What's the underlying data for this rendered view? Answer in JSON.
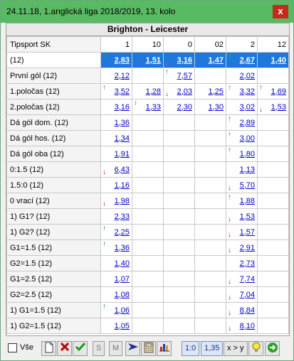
{
  "window": {
    "title": "24.11.18, 1.anglická liga 2018/2019, 13. kolo",
    "close_glyph": "x"
  },
  "match": "Brighton - Leicester",
  "header": [
    "Tipsport SK",
    "1",
    "10",
    "0",
    "02",
    "2",
    "12"
  ],
  "rows": [
    {
      "label": "(12)",
      "selected": true,
      "cells": [
        {
          "v": "2,83",
          "a": "up"
        },
        {
          "v": "1,51"
        },
        {
          "v": "3,16",
          "a": "down"
        },
        {
          "v": "1,47"
        },
        {
          "v": "2,67",
          "a": "up"
        },
        {
          "v": "1,40"
        }
      ]
    },
    {
      "label": "První gól  (12)",
      "cells": [
        {
          "v": "2,12"
        },
        {
          "v": ""
        },
        {
          "v": "7,57",
          "a": "up"
        },
        {
          "v": ""
        },
        {
          "v": "2,02"
        },
        {
          "v": ""
        }
      ]
    },
    {
      "label": "1.poločas  (12)",
      "cells": [
        {
          "v": "3,52",
          "a": "up"
        },
        {
          "v": "1,28"
        },
        {
          "v": "2,03",
          "a": "down"
        },
        {
          "v": "1,25"
        },
        {
          "v": "3,32",
          "a": "up"
        },
        {
          "v": "1,69",
          "a": "up"
        }
      ]
    },
    {
      "label": "2.poločas  (12)",
      "cells": [
        {
          "v": "3,16"
        },
        {
          "v": "1,33",
          "a": "up"
        },
        {
          "v": "2,30"
        },
        {
          "v": "1,30"
        },
        {
          "v": "3,02"
        },
        {
          "v": "1,53",
          "a": "down"
        }
      ]
    },
    {
      "label": "Dá gól dom.  (12)",
      "cells": [
        {
          "v": "1,36"
        },
        {
          "v": ""
        },
        {
          "v": ""
        },
        {
          "v": ""
        },
        {
          "v": "2,89",
          "a": "up"
        },
        {
          "v": ""
        }
      ]
    },
    {
      "label": "Dá gól hos.  (12)",
      "cells": [
        {
          "v": "1,34"
        },
        {
          "v": ""
        },
        {
          "v": ""
        },
        {
          "v": ""
        },
        {
          "v": "3,00",
          "a": "up"
        },
        {
          "v": ""
        }
      ]
    },
    {
      "label": "Dá gól oba  (12)",
      "cells": [
        {
          "v": "1,91"
        },
        {
          "v": ""
        },
        {
          "v": ""
        },
        {
          "v": ""
        },
        {
          "v": "1,80",
          "a": "up"
        },
        {
          "v": ""
        }
      ]
    },
    {
      "label": "0:1.5  (12)",
      "cells": [
        {
          "v": "6,43",
          "a": "down"
        },
        {
          "v": ""
        },
        {
          "v": ""
        },
        {
          "v": ""
        },
        {
          "v": "1,13"
        },
        {
          "v": ""
        }
      ]
    },
    {
      "label": "1.5:0  (12)",
      "cells": [
        {
          "v": "1,16"
        },
        {
          "v": ""
        },
        {
          "v": ""
        },
        {
          "v": ""
        },
        {
          "v": "5,70",
          "a": "down"
        },
        {
          "v": ""
        }
      ]
    },
    {
      "label": "0 vrací  (12)",
      "cells": [
        {
          "v": "1,98",
          "a": "down"
        },
        {
          "v": ""
        },
        {
          "v": ""
        },
        {
          "v": ""
        },
        {
          "v": "1,88",
          "a": "up"
        },
        {
          "v": ""
        }
      ]
    },
    {
      "label": "1) G1?  (12)",
      "cells": [
        {
          "v": "2,33"
        },
        {
          "v": ""
        },
        {
          "v": ""
        },
        {
          "v": ""
        },
        {
          "v": "1,53",
          "a": "down"
        },
        {
          "v": ""
        }
      ]
    },
    {
      "label": "1) G2?  (12)",
      "cells": [
        {
          "v": "2,25",
          "a": "up"
        },
        {
          "v": ""
        },
        {
          "v": ""
        },
        {
          "v": ""
        },
        {
          "v": "1,57",
          "a": "down"
        },
        {
          "v": ""
        }
      ]
    },
    {
      "label": "G1=1.5  (12)",
      "cells": [
        {
          "v": "1,36",
          "a": "up"
        },
        {
          "v": ""
        },
        {
          "v": ""
        },
        {
          "v": ""
        },
        {
          "v": "2,91",
          "a": "down"
        },
        {
          "v": ""
        }
      ]
    },
    {
      "label": "G2=1.5  (12)",
      "cells": [
        {
          "v": "1,40"
        },
        {
          "v": ""
        },
        {
          "v": ""
        },
        {
          "v": ""
        },
        {
          "v": "2,73"
        },
        {
          "v": ""
        }
      ]
    },
    {
      "label": "G1=2.5  (12)",
      "cells": [
        {
          "v": "1,07"
        },
        {
          "v": ""
        },
        {
          "v": ""
        },
        {
          "v": ""
        },
        {
          "v": "7,74",
          "a": "down"
        },
        {
          "v": ""
        }
      ]
    },
    {
      "label": "G2=2.5  (12)",
      "cells": [
        {
          "v": "1,08"
        },
        {
          "v": ""
        },
        {
          "v": ""
        },
        {
          "v": ""
        },
        {
          "v": "7,04",
          "a": "down"
        },
        {
          "v": ""
        }
      ]
    },
    {
      "label": "1) G1=1.5  (12)",
      "cells": [
        {
          "v": "1,06",
          "a": "up"
        },
        {
          "v": ""
        },
        {
          "v": ""
        },
        {
          "v": ""
        },
        {
          "v": "8,84",
          "a": "down"
        },
        {
          "v": ""
        }
      ]
    },
    {
      "label": "1) G2=1.5  (12)",
      "cells": [
        {
          "v": "1,05"
        },
        {
          "v": ""
        },
        {
          "v": ""
        },
        {
          "v": ""
        },
        {
          "v": "8,10",
          "a": "down"
        },
        {
          "v": ""
        }
      ]
    }
  ],
  "toolbar": {
    "all_label": "Vše",
    "s_label": "S",
    "m_label": "M",
    "ratio_label": "1:0",
    "odds_label": "1,35",
    "compare_label": "x > y"
  },
  "colors": {
    "titlebar": "#58bb63",
    "selected_row": "#1e78dc",
    "link": "#0000cc",
    "up_arrow": "#109030",
    "down_arrow": "#d01010"
  }
}
